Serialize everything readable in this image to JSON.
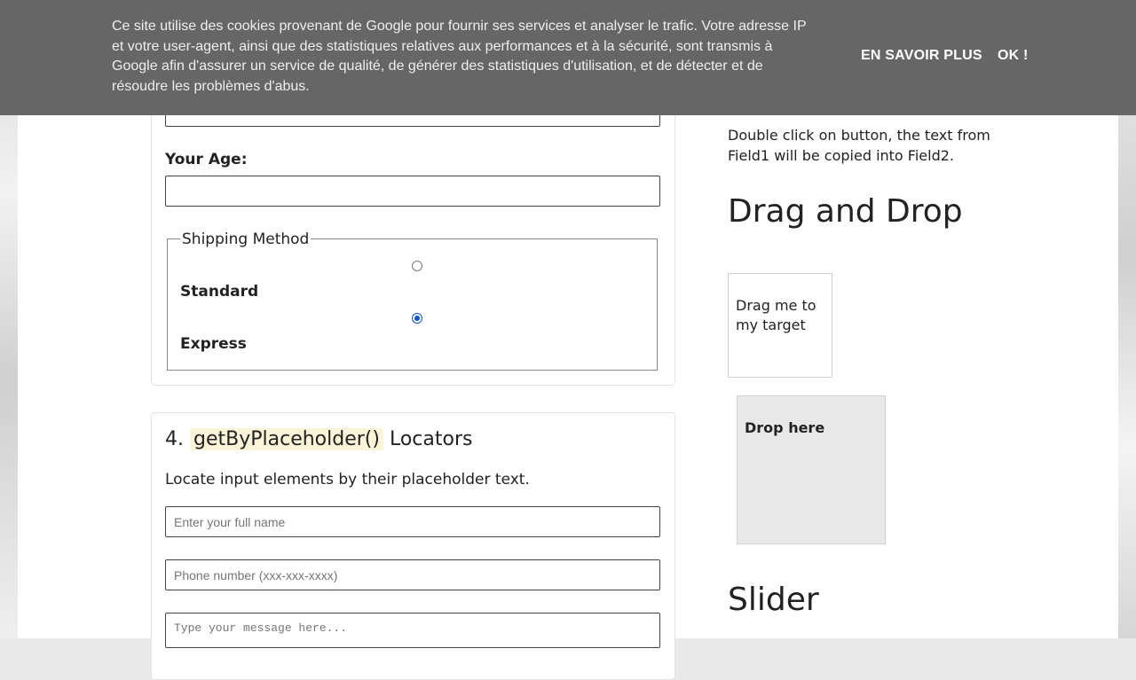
{
  "cookie_bar": {
    "text": "Ce site utilise des cookies provenant de Google pour fournir ses services et analyser le trafic. Votre adresse IP et votre user-agent, ainsi que des statistiques relatives aux performances et à la sécurité, sont transmis à Google afin d'assurer un service de qualité, de générer des statistiques d'utilisation, et de détecter et de résoudre les problèmes d'abus.",
    "learn_more": "EN SAVOIR PLUS",
    "ok": "OK !"
  },
  "form": {
    "age_label": "Your Age:",
    "age_value": "",
    "shipping": {
      "legend": "Shipping Method",
      "options": [
        {
          "label": "Standard",
          "checked": false
        },
        {
          "label": "Express",
          "checked": true
        }
      ]
    }
  },
  "placeholder_section": {
    "number": "4.",
    "method": "getByPlaceholder()",
    "suffix": "Locators",
    "description": "Locate input elements by their placeholder text.",
    "inputs": [
      {
        "placeholder": "Enter your full name"
      },
      {
        "placeholder": "Phone number (xxx-xxx-xxxx)"
      },
      {
        "placeholder": "Type your message here..."
      }
    ]
  },
  "sidebar": {
    "double_click_text": "Double click on button, the text from Field1 will be copied into Field2.",
    "drag_drop_title": "Drag and Drop",
    "drag_text": "Drag me to my target",
    "drop_text": "Drop here",
    "slider_title": "Slider"
  }
}
